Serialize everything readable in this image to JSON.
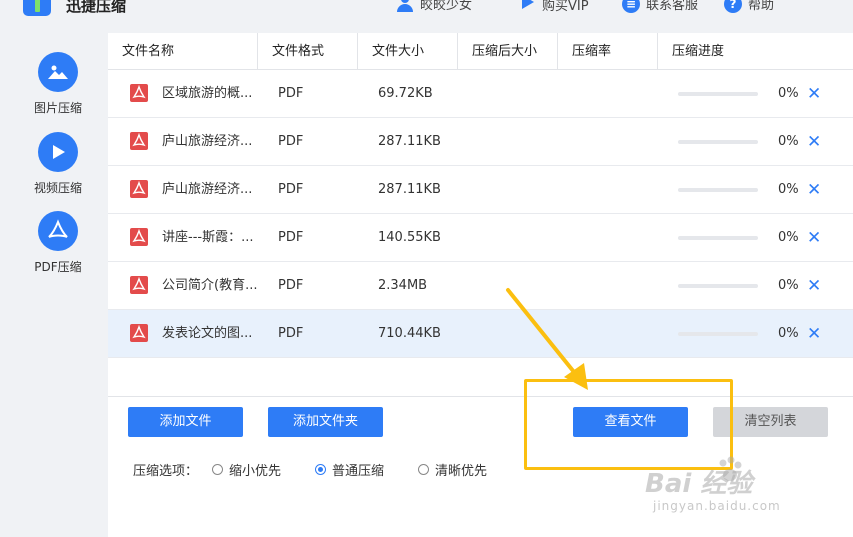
{
  "app": {
    "title": "迅捷压缩"
  },
  "header": {
    "user": "皎皎少女",
    "vip": "购买VIP",
    "service": "联系客服",
    "help": "帮助"
  },
  "sidebar": {
    "items": [
      {
        "label": "图片压缩",
        "icon": "image-icon"
      },
      {
        "label": "视频压缩",
        "icon": "play-icon"
      },
      {
        "label": "PDF压缩",
        "icon": "pdf-icon"
      }
    ]
  },
  "table": {
    "columns": [
      "文件名称",
      "文件格式",
      "文件大小",
      "压缩后大小",
      "压缩率",
      "压缩进度"
    ],
    "rows": [
      {
        "name": "区域旅游的概...",
        "format": "PDF",
        "size": "69.72KB",
        "progress": "0%",
        "progress_value": 0
      },
      {
        "name": "庐山旅游经济...",
        "format": "PDF",
        "size": "287.11KB",
        "progress": "0%",
        "progress_value": 0
      },
      {
        "name": "庐山旅游经济...",
        "format": "PDF",
        "size": "287.11KB",
        "progress": "0%",
        "progress_value": 0
      },
      {
        "name": "讲座---斯霞：...",
        "format": "PDF",
        "size": "140.55KB",
        "progress": "0%",
        "progress_value": 0
      },
      {
        "name": "公司简介(教育...",
        "format": "PDF",
        "size": "2.34MB",
        "progress": "0%",
        "progress_value": 0
      },
      {
        "name": "发表论文的图...",
        "format": "PDF",
        "size": "710.44KB",
        "progress": "0%",
        "progress_value": 0
      }
    ],
    "selected_row": 5,
    "delete_glyph": "✕"
  },
  "buttons": {
    "add_file": "添加文件",
    "add_folder": "添加文件夹",
    "view_files": "查看文件",
    "clear_list": "清空列表"
  },
  "options": {
    "title": "压缩选项：",
    "choices": [
      "缩小优先",
      "普通压缩",
      "清晰优先"
    ],
    "selected": 1
  },
  "colors": {
    "accent": "#2e7cf6",
    "highlight": "#fbbf10",
    "pdf_red": "#e34b4b"
  },
  "watermark": {
    "logo": "Bai 经验",
    "url": "jingyan.baidu.com"
  }
}
